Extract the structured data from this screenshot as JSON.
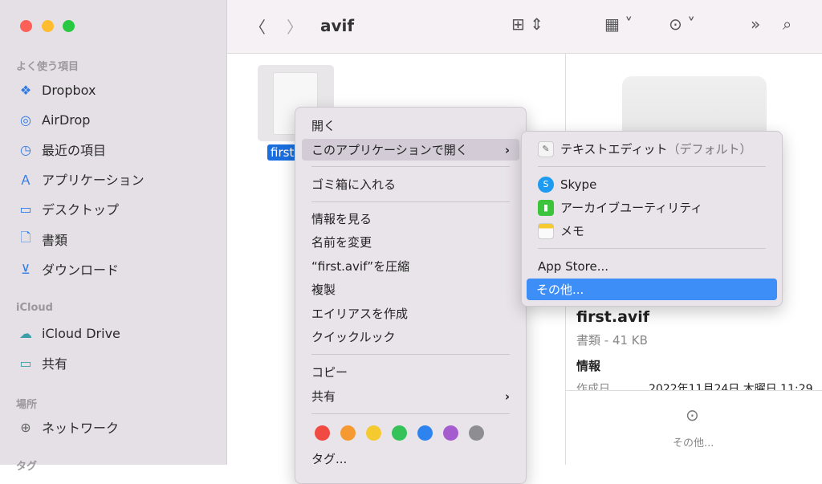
{
  "window": {
    "title": "avif",
    "traffic_lights": [
      "#fe5f57",
      "#febc2e",
      "#28c840"
    ]
  },
  "sidebar": {
    "sections": [
      {
        "label": "よく使う項目",
        "items": [
          {
            "label": "Dropbox",
            "icon": "dropbox-icon"
          },
          {
            "label": "AirDrop",
            "icon": "airdrop-icon"
          },
          {
            "label": "最近の項目",
            "icon": "clock-icon"
          },
          {
            "label": "アプリケーション",
            "icon": "applications-icon"
          },
          {
            "label": "デスクトップ",
            "icon": "desktop-icon"
          },
          {
            "label": "書類",
            "icon": "document-icon"
          },
          {
            "label": "ダウンロード",
            "icon": "download-icon"
          }
        ]
      },
      {
        "label": "iCloud",
        "items": [
          {
            "label": "iCloud Drive",
            "icon": "cloud-icon"
          },
          {
            "label": "共有",
            "icon": "shared-folder-icon"
          }
        ]
      },
      {
        "label": "場所",
        "items": [
          {
            "label": "ネットワーク",
            "icon": "globe-icon"
          }
        ]
      },
      {
        "label": "タグ"
      }
    ]
  },
  "file": {
    "name_short": "first",
    "name": "first.avif",
    "kind_size": "書類 - 41 KB",
    "info_heading": "情報",
    "created_label": "作成日",
    "created_value": "2022年11月24日 木曜日 11:29"
  },
  "context_menu": {
    "items": [
      "開く",
      "このアプリケーションで開く",
      "ゴミ箱に入れる",
      "情報を見る",
      "名前を変更",
      "“first.avif”を圧縮",
      "複製",
      "エイリアスを作成",
      "クイックルック",
      "コピー",
      "共有",
      "タグ..."
    ],
    "tag_colors": [
      "#f04a43",
      "#f59a32",
      "#f5c930",
      "#35c359",
      "#2d84ee",
      "#a55ccf",
      "#8e8e92"
    ]
  },
  "submenu": {
    "items": [
      "テキストエディット",
      "（デフォルト）",
      "Skype",
      "アーカイブユーティリティ",
      "メモ",
      "App Store...",
      "その他..."
    ]
  },
  "preview": {
    "more_label": "その他..."
  }
}
